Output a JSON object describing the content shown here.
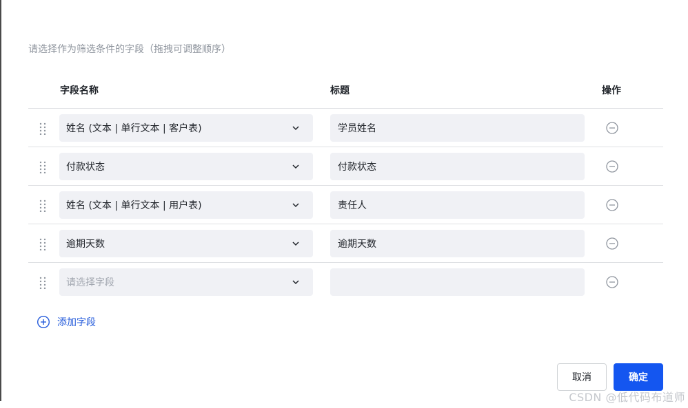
{
  "dialog": {
    "hint": "请选择作为筛选条件的字段（拖拽可调整顺序）",
    "columns": {
      "field": "字段名称",
      "title": "标题",
      "action": "操作"
    },
    "rows": [
      {
        "field": "姓名 (文本 | 单行文本 | 客户表)",
        "title": "学员姓名"
      },
      {
        "field": "付款状态",
        "title": "付款状态"
      },
      {
        "field": "姓名 (文本 | 单行文本 | 用户表)",
        "title": "责任人"
      },
      {
        "field": "逾期天数",
        "title": "逾期天数"
      },
      {
        "field": "",
        "field_placeholder": "请选择字段",
        "title": ""
      }
    ],
    "add_field_label": "添加字段",
    "cancel_label": "取消",
    "ok_label": "确定"
  },
  "watermark": "CSDN @低代码布道师",
  "icons": {
    "drag": "drag-handle-icon",
    "chevron": "chevron-down-icon",
    "remove": "minus-circle-icon",
    "add": "plus-circle-icon"
  },
  "colors": {
    "primary": "#1456f0",
    "link": "#245bdb",
    "input_bg": "#f0f1f5",
    "border": "#dee0e3"
  }
}
